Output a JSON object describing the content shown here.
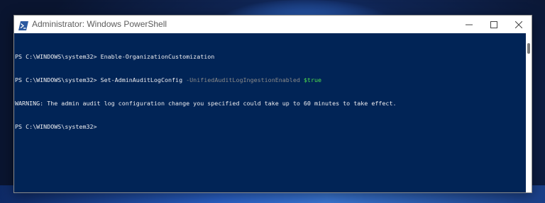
{
  "window": {
    "title": "Administrator: Windows PowerShell",
    "icon": "powershell-icon",
    "controls": {
      "minimize": "minimize-icon",
      "maximize": "maximize-icon",
      "close": "close-icon"
    }
  },
  "console": {
    "background": "#012456",
    "text_color": "#EEEDF0",
    "lines": [
      {
        "prompt": "PS C:\\WINDOWS\\system32> ",
        "command": "Enable-OrganizationCustomization",
        "parameter": "",
        "value": ""
      },
      {
        "prompt": "PS C:\\WINDOWS\\system32> ",
        "command": "Set-AdminAuditLogConfig",
        "parameter": " -UnifiedAuditLogIngestionEnabled ",
        "value": "$true"
      },
      {
        "text": "WARNING: The admin audit log configuration change you specified could take up to 60 minutes to take effect."
      },
      {
        "prompt": "PS C:\\WINDOWS\\system32> ",
        "command": "",
        "parameter": "",
        "value": ""
      }
    ]
  },
  "colors": {
    "parameter": "#8A8A8A",
    "variable": "#4EE04E"
  }
}
